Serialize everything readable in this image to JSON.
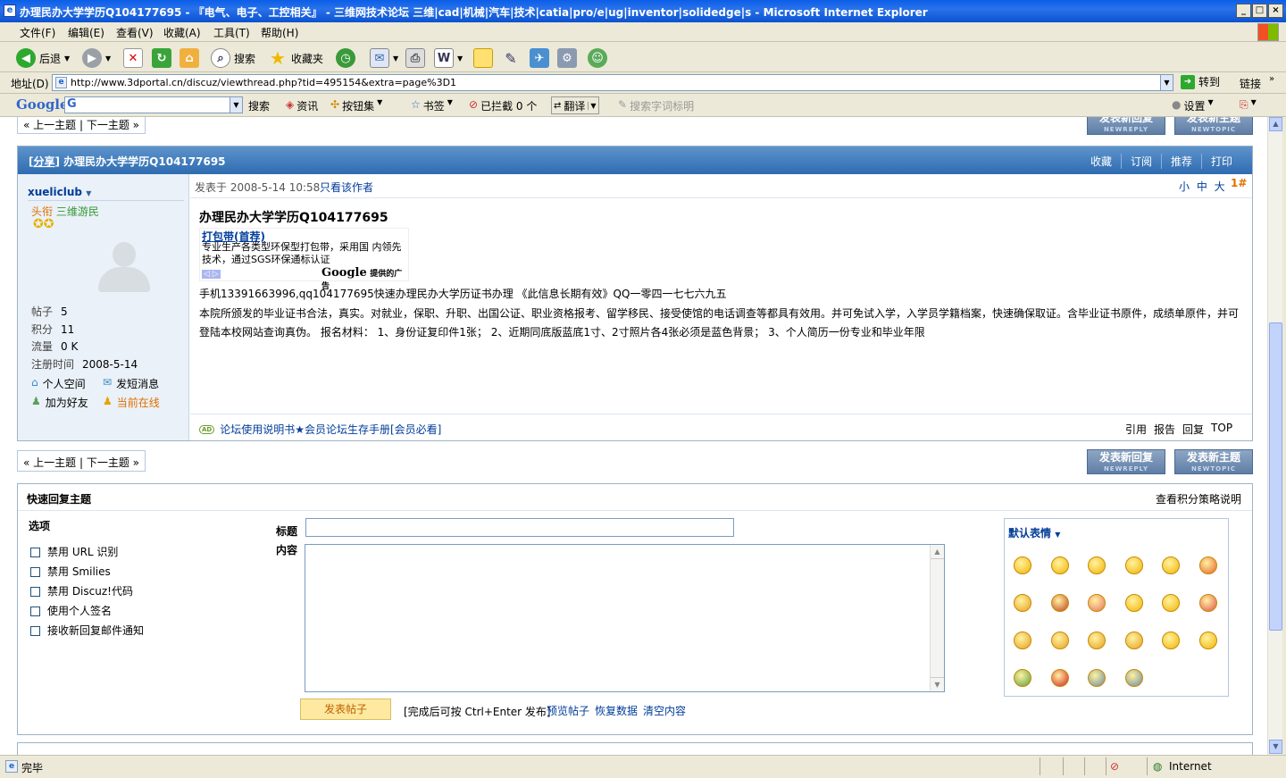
{
  "window": {
    "title": "办理民办大学学历Q104177695 - 『电气、电子、工控相关』 - 三维网技术论坛 三维|cad|机械|汽车|技术|catia|pro/e|ug|inventor|solidedge|s - Microsoft Internet Explorer"
  },
  "menu": [
    "文件(F)",
    "编辑(E)",
    "查看(V)",
    "收藏(A)",
    "工具(T)",
    "帮助(H)"
  ],
  "toolbar": {
    "back": "后退",
    "search": "搜索",
    "favorites": "收藏夹"
  },
  "address": {
    "label": "地址(D)",
    "url": "http://www.3dportal.cn/discuz/viewthread.php?tid=495154&extra=page%3D1",
    "go": "转到",
    "links": "链接"
  },
  "google_bar": {
    "logo": "Google",
    "search": "搜索",
    "news": "资讯",
    "buttons": "按钮集",
    "bookmarks": "书签",
    "blocked": "已拦截 0 个",
    "translate": "翻译",
    "highlight": "搜索字词标明",
    "settings": "设置"
  },
  "nav": {
    "prev_next": "« 上一主题 | 下一主题 »",
    "reply_button": "发表新回复",
    "reply_button_en": "NEWREPLY",
    "topic_button": "发表新主题",
    "topic_button_en": "NEWTOPIC"
  },
  "post": {
    "tag": "分享",
    "title": "办理民办大学学历Q104177695",
    "actions": [
      "收藏",
      "订阅",
      "推荐",
      "打印"
    ],
    "author": {
      "name": "xueliclub",
      "rank_label": "头衔",
      "rank": "三维游民",
      "stats": [
        {
          "label": "帖子",
          "value": "5"
        },
        {
          "label": "积分",
          "value": "11"
        },
        {
          "label": "流量",
          "value": "0 K"
        },
        {
          "label": "注册时间",
          "value": "2008-5-14"
        }
      ],
      "links": [
        "个人空间",
        "发短消息",
        "加为好友",
        "当前在线"
      ]
    },
    "meta": {
      "posted": "发表于  2008-5-14 10:58",
      "author_only": "只看该作者",
      "font_sizes": "小 中 大",
      "floor": "1#"
    },
    "heading": "办理民办大学学历Q104177695",
    "ad": {
      "title": "打包带(首荐)",
      "text": "专业生产各类型环保型打包带，采用国 内领先技术，通过SGS环保通标认证",
      "provider": "提供的广告"
    },
    "body_line1": "手机13391663996,qq104177695快速办理民办大学历证书办理 《此信息长期有效》QQ一零四一七七六九五",
    "body_line2": "本院所颁发的毕业证书合法，真实。对就业，保职、升职、出国公证、职业资格报考、留学移民、接受使馆的电话调查等都具有效用。并可免试入学，入学员学籍档案，快速确保取证。含毕业证书原件，成绩单原件，并可登陆本校网站查询真伪。   报名材料：   1、身份证复印件1张；   2、近期同底版蓝底1寸、2寸照片各4张必须是蓝色背景；   3、个人简历一份专业和毕业年限",
    "footer_ad": "论坛使用说明书★会员论坛生存手册[会员必看]",
    "footer_actions": [
      "引用",
      "报告",
      "回复",
      "TOP"
    ]
  },
  "quick_reply": {
    "title": "快速回复主题",
    "policy": "查看积分策略说明",
    "options_title": "选项",
    "options": [
      "禁用 URL 识别",
      "禁用 Smilies",
      "禁用 Discuz!代码",
      "使用个人签名",
      "接收新回复邮件通知"
    ],
    "subject_label": "标题",
    "content_label": "内容",
    "submit": "发表帖子",
    "hint": "[完成后可按 Ctrl+Enter 发布]",
    "preview": "预览帖子",
    "restore": "恢复数据",
    "clear": "清空内容",
    "smilies_title": "默认表情"
  },
  "status": {
    "text": "完毕",
    "zone": "Internet"
  }
}
